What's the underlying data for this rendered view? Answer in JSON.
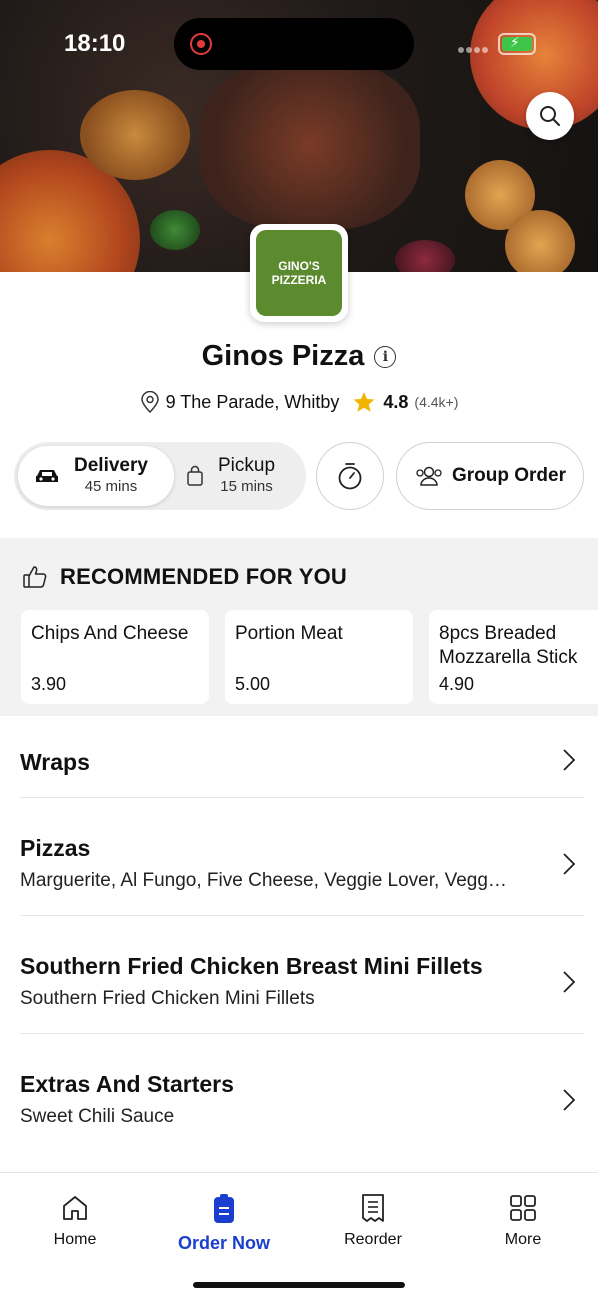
{
  "status": {
    "time": "18:10"
  },
  "restaurant": {
    "logo_line1": "GINO'S",
    "logo_line2": "PIZZERIA",
    "name": "Ginos Pizza",
    "address": "9 The Parade, Whitby",
    "rating": "4.8",
    "reviews": "(4.4k+)"
  },
  "order_type": {
    "delivery": {
      "label": "Delivery",
      "time": "45 mins"
    },
    "pickup": {
      "label": "Pickup",
      "time": "15 mins"
    },
    "group_order": "Group Order"
  },
  "recommended": {
    "title": "RECOMMENDED FOR YOU",
    "items": [
      {
        "name": "Chips And Cheese",
        "price": "3.90"
      },
      {
        "name": "Portion Meat",
        "price": "5.00"
      },
      {
        "name": "8pcs Breaded Mozzarella Stick",
        "price": "4.90"
      }
    ]
  },
  "categories": [
    {
      "name": "Wraps",
      "desc": ""
    },
    {
      "name": "Pizzas",
      "desc": "Marguerite, Al Fungo, Five Cheese, Veggie Lover, Vegg…"
    },
    {
      "name": "Southern Fried Chicken Breast Mini Fillets",
      "desc": "Southern Fried Chicken Mini Fillets"
    },
    {
      "name": "Extras And Starters",
      "desc": "Sweet Chili Sauce"
    }
  ],
  "tabs": [
    {
      "label": "Home",
      "icon": "home-icon"
    },
    {
      "label": "Order Now",
      "icon": "order-icon"
    },
    {
      "label": "Reorder",
      "icon": "receipt-icon"
    },
    {
      "label": "More",
      "icon": "grid-icon"
    }
  ],
  "colors": {
    "accent": "#1a3fcf",
    "logo_bg": "#5b8a2f",
    "star": "#f2b400"
  }
}
